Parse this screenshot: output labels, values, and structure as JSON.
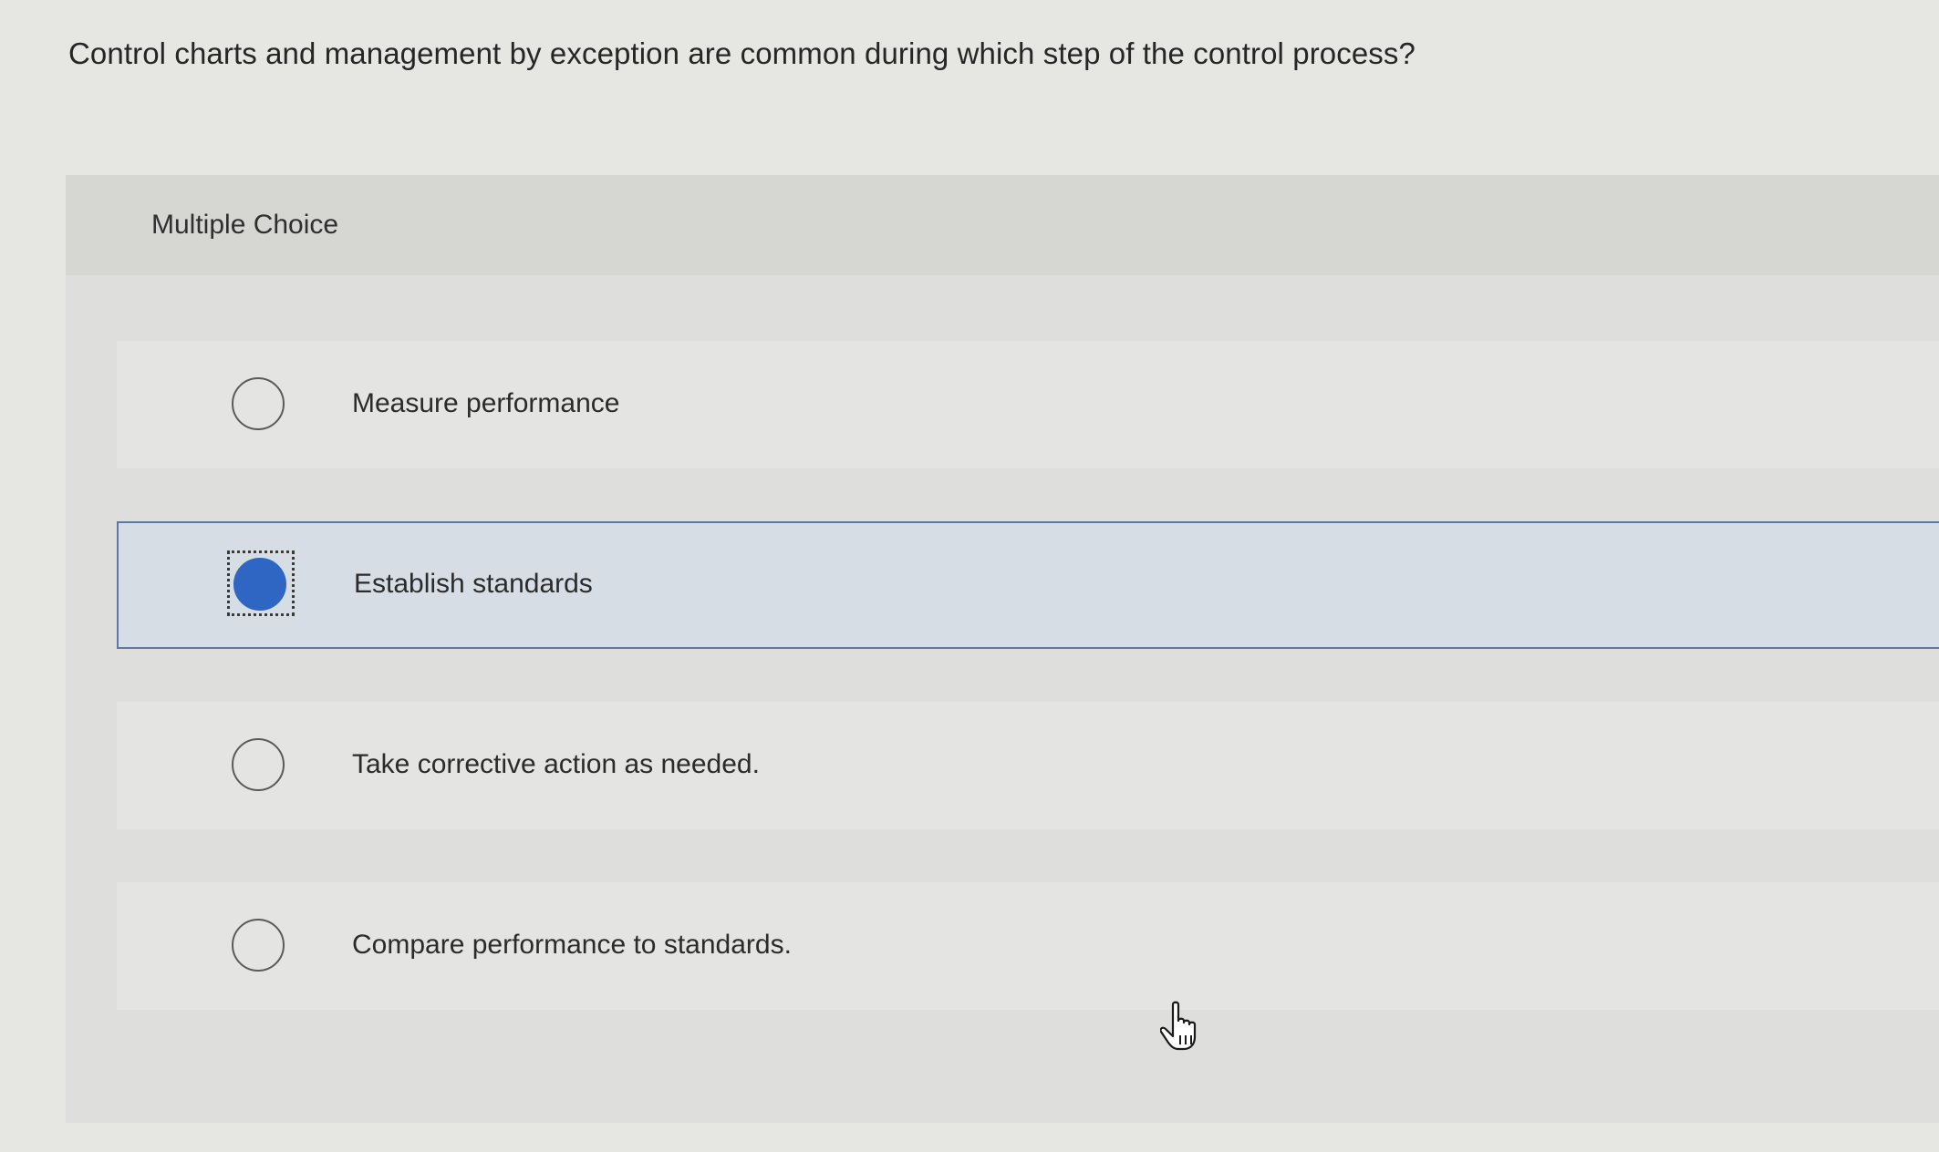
{
  "question": {
    "text": "Control charts and management by exception are common during which step of the control process?"
  },
  "quiz": {
    "type_label": "Multiple Choice",
    "options": [
      {
        "label": "Measure performance",
        "selected": false
      },
      {
        "label": "Establish standards",
        "selected": true
      },
      {
        "label": "Take corrective action as needed.",
        "selected": false
      },
      {
        "label": "Compare performance to standards.",
        "selected": false
      }
    ]
  },
  "colors": {
    "background": "#e6e6e3",
    "selected_radio": "#2f66c4",
    "selected_border": "#5a78a8",
    "selected_background": "#d7dde4"
  },
  "icons": {
    "pointer": "hand-pointer-icon"
  }
}
